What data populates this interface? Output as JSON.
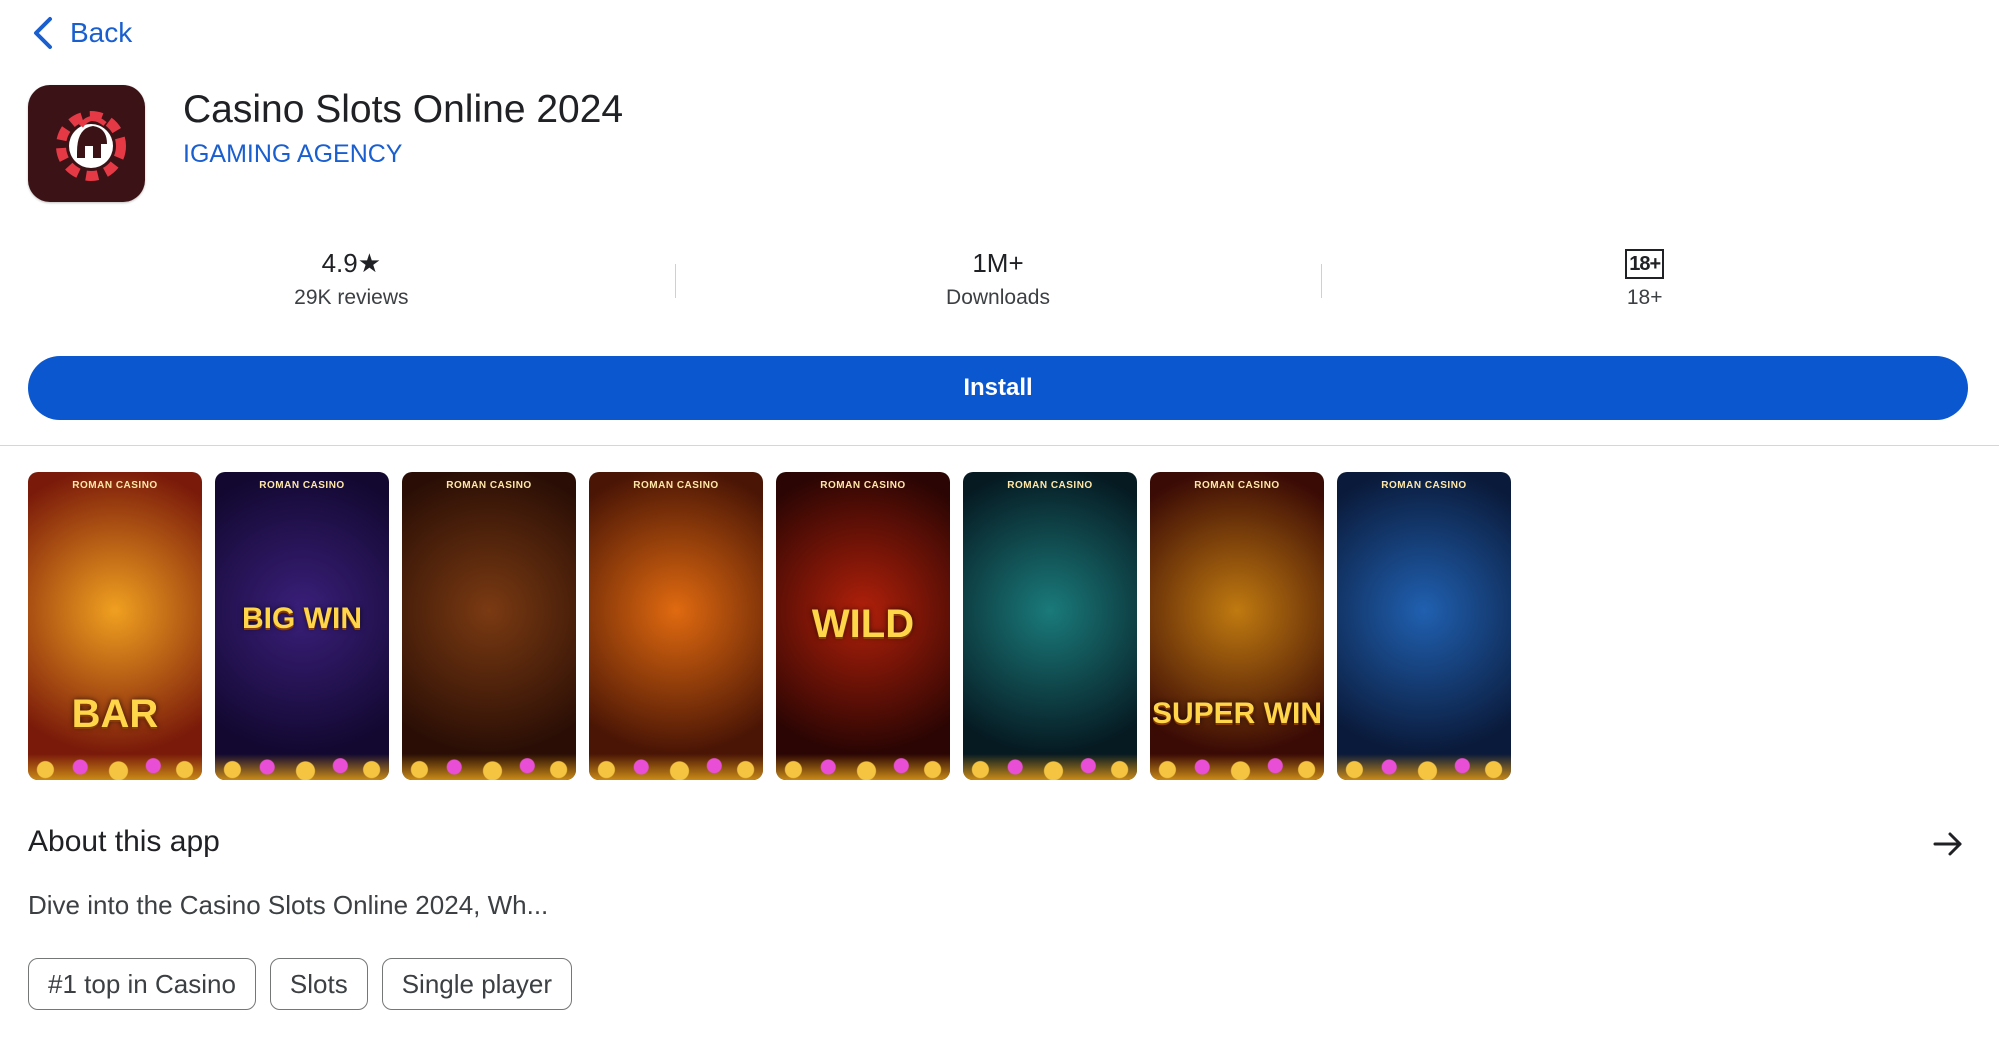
{
  "nav": {
    "back_label": "Back"
  },
  "app": {
    "title": "Casino Slots Online 2024",
    "developer": "IGAMING AGENCY",
    "icon": "roman-helmet-chip-icon"
  },
  "stats": {
    "rating": {
      "value": "4.9",
      "star": "★",
      "label": "29K reviews"
    },
    "downloads": {
      "value": "1M+",
      "label": "Downloads"
    },
    "age": {
      "badge": "18+",
      "label": "18+"
    }
  },
  "install_label": "Install",
  "screenshots": [
    {
      "brand": "ROMAN CASINO",
      "caption": "BAR",
      "theme": [
        "#f0a020",
        "#7a1a0a"
      ]
    },
    {
      "brand": "ROMAN CASINO",
      "caption": "BIG WIN",
      "theme": [
        "#3a1f7a",
        "#120830"
      ]
    },
    {
      "brand": "ROMAN CASINO",
      "caption": "",
      "theme": [
        "#7a3a12",
        "#2a0e05"
      ]
    },
    {
      "brand": "ROMAN CASINO",
      "caption": "",
      "theme": [
        "#e06a10",
        "#4a1505"
      ]
    },
    {
      "brand": "ROMAN CASINO",
      "caption": "WILD",
      "theme": [
        "#b0200a",
        "#2a0503"
      ]
    },
    {
      "brand": "ROMAN CASINO",
      "caption": "",
      "theme": [
        "#1a7a7a",
        "#061a22"
      ]
    },
    {
      "brand": "ROMAN CASINO",
      "caption": "SUPER WIN",
      "theme": [
        "#c07a10",
        "#3a0a05"
      ]
    },
    {
      "brand": "ROMAN CASINO",
      "caption": "",
      "theme": [
        "#2060b0",
        "#0a1a3a"
      ]
    }
  ],
  "about": {
    "title": "About this app",
    "description": "Dive into the Casino Slots Online 2024, Wh...",
    "tags": [
      "#1 top in Casino",
      "Slots",
      "Single player"
    ]
  },
  "colors": {
    "accent": "#0b57d0",
    "link": "#1a5fd0"
  }
}
